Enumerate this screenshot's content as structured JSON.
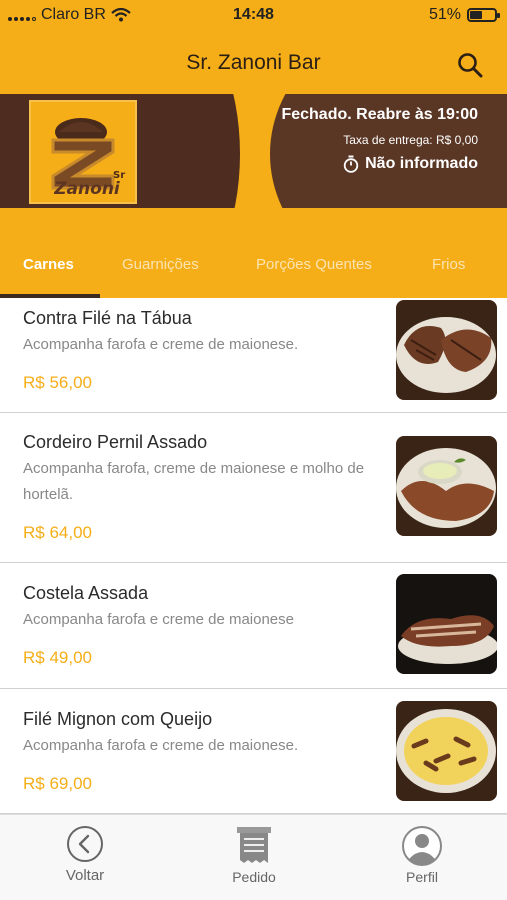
{
  "status_bar": {
    "carrier": "Claro BR",
    "time": "14:48",
    "battery": "51%",
    "battery_level": 0.51
  },
  "header": {
    "title": "Sr. Zanoni Bar"
  },
  "store": {
    "logo_text": "Zanoni",
    "logo_prefix": "Sr",
    "status": "Fechado. Reabre às 19:00",
    "delivery_fee": "Taxa de entrega: R$ 0,00",
    "delivery_time": "Não informado"
  },
  "tabs": [
    {
      "label": "Carnes",
      "active": true
    },
    {
      "label": "Guarnições",
      "active": false
    },
    {
      "label": "Porções Quentes",
      "active": false
    },
    {
      "label": "Frios",
      "active": false
    }
  ],
  "menu_items": [
    {
      "name": "Contra Filé na Tábua",
      "description": "Acompanha farofa e creme de maionese.",
      "price": "R$ 56,00"
    },
    {
      "name": "Cordeiro Pernil Assado",
      "description": "Acompanha farofa, creme de maionese e molho de hortelã.",
      "price": "R$ 64,00"
    },
    {
      "name": "Costela Assada",
      "description": "Acompanha farofa e creme de maionese",
      "price": "R$ 49,00"
    },
    {
      "name": "Filé Mignon com Queijo",
      "description": "Acompanha farofa e creme de maionese.",
      "price": "R$ 69,00"
    }
  ],
  "bottom_nav": [
    {
      "label": "Voltar",
      "icon": "back-circle-icon"
    },
    {
      "label": "Pedido",
      "icon": "receipt-icon"
    },
    {
      "label": "Perfil",
      "icon": "profile-icon"
    }
  ],
  "colors": {
    "primary": "#f5ae18",
    "brown": "#4e2d20",
    "price": "#f5ae18"
  }
}
